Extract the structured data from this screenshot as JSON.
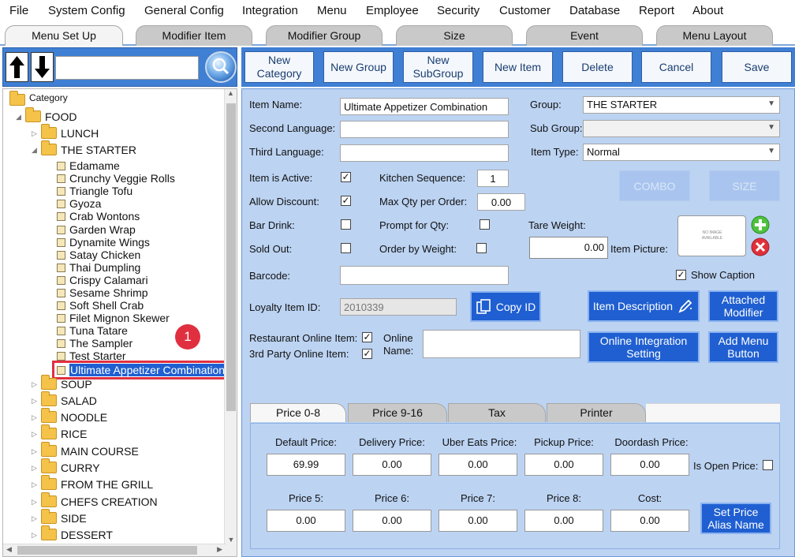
{
  "menubar": {
    "items": [
      "File",
      "System Config",
      "General Config",
      "Integration",
      "Menu",
      "Employee",
      "Security",
      "Customer",
      "Database",
      "Report",
      "About"
    ]
  },
  "top_tabs": [
    "Menu Set Up",
    "Modifier Item",
    "Modifier Group",
    "Size",
    "Event",
    "Menu Layout"
  ],
  "left": {
    "search_value": "",
    "tree": {
      "root": "Category",
      "food": "FOOD",
      "groups_before": [
        "LUNCH",
        "THE STARTER"
      ],
      "starter_items": [
        "Edamame",
        "Crunchy Veggie Rolls",
        "Triangle Tofu",
        "Gyoza",
        "Crab Wontons",
        "Garden Wrap",
        "Dynamite Wings",
        "Satay Chicken",
        "Thai Dumpling",
        "Crispy Calamari",
        "Sesame Shrimp",
        "Soft Shell Crab",
        "Filet Mignon Skewer",
        "Tuna Tatare",
        "The Sampler",
        "Test Starter",
        "Ultimate Appetizer Combination"
      ],
      "groups_after": [
        "SOUP",
        "SALAD",
        "NOODLE",
        "RICE",
        "MAIN COURSE",
        "CURRY",
        "FROM THE GRILL",
        "CHEFS CREATION",
        "SIDE",
        "DESSERT"
      ]
    },
    "badge": "1"
  },
  "toolbar": {
    "new_category": "New Category",
    "new_group": "New Group",
    "new_subgroup": "New SubGroup",
    "new_item": "New Item",
    "delete": "Delete",
    "cancel": "Cancel",
    "save": "Save"
  },
  "form": {
    "item_name_label": "Item Name:",
    "item_name_value": "Ultimate Appetizer Combination",
    "second_language_label": "Second Language:",
    "third_language_label": "Third Language:",
    "group_label": "Group:",
    "group_value": "THE STARTER",
    "sub_group_label": "Sub Group:",
    "item_type_label": "Item Type:",
    "item_type_value": "Normal",
    "item_active_label": "Item is Active:",
    "allow_discount_label": "Allow Discount:",
    "bar_drink_label": "Bar Drink:",
    "sold_out_label": "Sold Out:",
    "kitchen_seq_label": "Kitchen Sequence:",
    "kitchen_seq_value": "1",
    "max_qty_label": "Max Qty per Order:",
    "max_qty_value": "0.00",
    "prompt_qty_label": "Prompt for Qty:",
    "order_weight_label": "Order by Weight:",
    "tare_weight_label": "Tare Weight:",
    "tare_weight_value": "0.00",
    "item_picture_label": "Item Picture:",
    "picture_placeholder": "NO IMAGE AVAILABLE",
    "combo": "COMBO",
    "size": "SIZE",
    "show_caption_label": "Show Caption",
    "barcode_label": "Barcode:",
    "loyalty_label": "Loyalty Item ID:",
    "loyalty_value": "2010339",
    "copy_id": "Copy ID",
    "item_description": "Item Description",
    "attached_modifier": "Attached Modifier",
    "restaurant_online_label": "Restaurant Online Item:",
    "third_party_label": "3rd Party Online Item:",
    "online_name_label": "Online Name:",
    "online_integration": "Online Integration Setting",
    "add_menu_button": "Add Menu Button"
  },
  "price_tabs": [
    "Price 0-8",
    "Price 9-16",
    "Tax",
    "Printer"
  ],
  "prices": {
    "row1_labels": [
      "Default Price:",
      "Delivery Price:",
      "Uber Eats Price:",
      "Pickup Price:",
      "Doordash Price:"
    ],
    "row1_values": [
      "69.99",
      "0.00",
      "0.00",
      "0.00",
      "0.00"
    ],
    "row2_labels": [
      "Price 5:",
      "Price 6:",
      "Price 7:",
      "Price 8:",
      "Cost:"
    ],
    "row2_values": [
      "0.00",
      "0.00",
      "0.00",
      "0.00",
      "0.00"
    ],
    "is_open_price_label": "Is Open Price:",
    "set_price_alias": "Set Price Alias Name"
  },
  "colors": {
    "accent_blue": "#3f7fd4",
    "form_bg": "#bcd3f2",
    "action_blue": "#1f5fd1",
    "highlight_red": "#e03040"
  }
}
